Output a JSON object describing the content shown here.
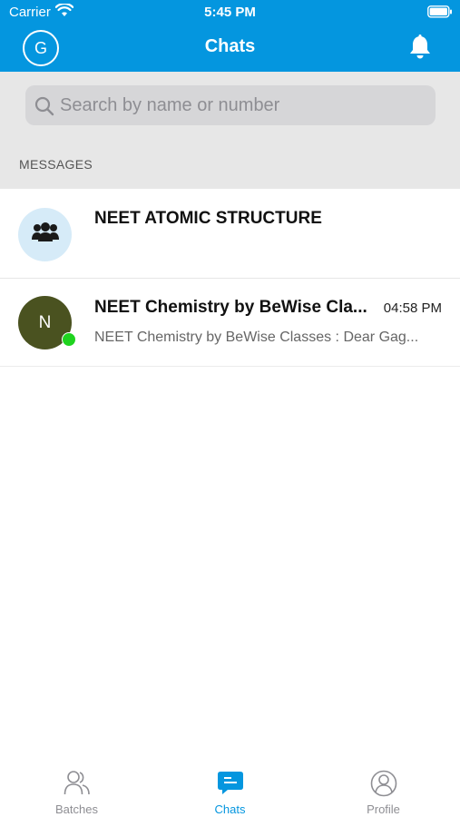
{
  "status_bar": {
    "carrier": "Carrier",
    "time": "5:45 PM"
  },
  "header": {
    "avatar_initial": "G",
    "title": "Chats"
  },
  "search": {
    "placeholder": "Search by name or number"
  },
  "section_label": "MESSAGES",
  "chats": [
    {
      "title": "NEET ATOMIC STRUCTURE",
      "avatar": "group-icon"
    },
    {
      "title": "NEET Chemistry by BeWise Cla...",
      "time": "04:58 PM",
      "preview": "NEET Chemistry by BeWise Classes : Dear Gag...",
      "avatar_initial": "N",
      "online": true
    }
  ],
  "tabs": [
    {
      "label": "Batches",
      "icon": "batches-icon",
      "active": false
    },
    {
      "label": "Chats",
      "icon": "chat-icon",
      "active": true
    },
    {
      "label": "Profile",
      "icon": "profile-icon",
      "active": false
    }
  ],
  "colors": {
    "accent": "#0496df",
    "online": "#1fd31f",
    "avatar_n": "#4a5220"
  }
}
